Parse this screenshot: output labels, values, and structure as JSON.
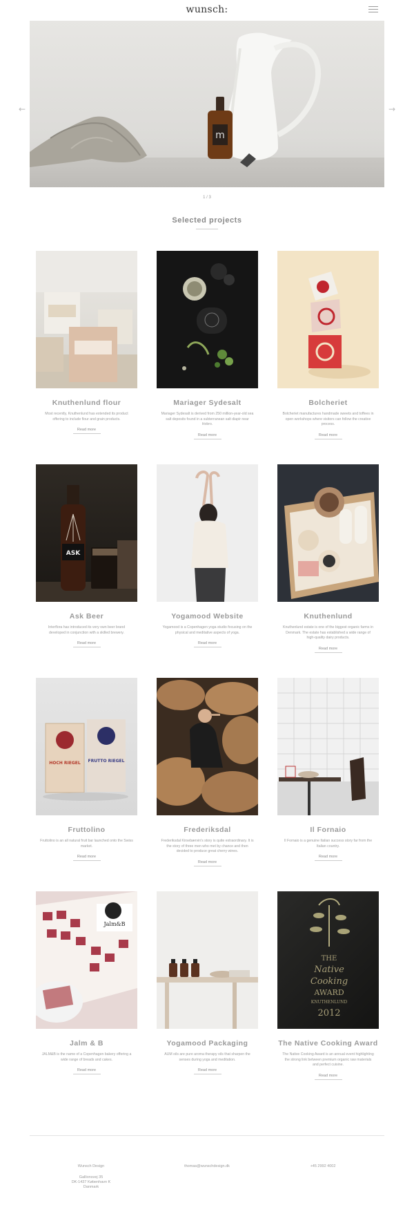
{
  "header": {
    "logo": "wunsch:"
  },
  "hero": {
    "counter": "1 / 3"
  },
  "section_title": "Selected projects",
  "projects": [
    {
      "title": "Knuthenlund flour",
      "desc": "Most recently, Knuthenlund has extended its product offering to include flour and grain products.",
      "more": "Read more"
    },
    {
      "title": "Mariager Sydesalt",
      "desc": "Mariager Sydesalt is derived from 250 million-year-old sea salt deposits found in a subterranean salt diapir near Hobro.",
      "more": "Read more"
    },
    {
      "title": "Bolcheriet",
      "desc": "Bolcheriet manufactures handmade sweets and toffees in open workshops where visitors can follow the creative process.",
      "more": "Read more"
    },
    {
      "title": "Ask Beer",
      "desc": "Interflora has introduced its very own beer brand developed in conjunction with a skilled brewery.",
      "more": "Read more"
    },
    {
      "title": "Yogamood Website",
      "desc": "Yogamood is a Copenhagen yoga studio focusing on the physical and meditative aspects of yoga.",
      "more": "Read more"
    },
    {
      "title": "Knuthenlund",
      "desc": "Knuthenlund estate is one of the biggest organic farms in Denmark. The estate has established a wide range of high-quality dairy products.",
      "more": "Read more"
    },
    {
      "title": "Fruttolino",
      "desc": "Fruttolino is an all natural fruit bar launched onto the Swiss market.",
      "more": "Read more"
    },
    {
      "title": "Frederiksdal",
      "desc": "Frederiksdal Kirsebærvin's story is quite extraordinary. It is the story of three men who met by chance and then decided to produce great cherry wines.",
      "more": "Read more"
    },
    {
      "title": "Il Fornaio",
      "desc": "Il Fornaio is a genuine Italian success story far from the Italian country.",
      "more": "Read more"
    },
    {
      "title": "Jalm & B",
      "desc": "JALM&B is the name of a Copenhagen bakery offering a wide range of breads and cakes.",
      "more": "Read more"
    },
    {
      "title": "Yogamood Packaging",
      "desc": "AUM oils are pure aroma therapy oils that sharpen the senses during yoga and meditation.",
      "more": "Read more"
    },
    {
      "title": "The Native Cooking Award",
      "desc": "The Native Cooking Award is an annual event highlighting the strong link between premium organic raw materials and perfect cuisine.",
      "more": "Read more"
    }
  ],
  "footer": {
    "company": "Wunsch Design",
    "address1": "Gallionsvej 35",
    "address2": "DK-1437 København K",
    "country": "Danmark",
    "email": "thomas@wunschdesign.dk",
    "phone": "+45 2992 4002"
  },
  "image_text": {
    "bottle_label": "m",
    "ask_label": "ASK",
    "fruttolino_a": "HOCH RIEGEL",
    "fruttolino_b": "FRUTTO RIEGEL",
    "jalm_logo": "Jalm&B",
    "award_line1": "THE",
    "award_line2": "Native",
    "award_line3": "Cooking",
    "award_line4": "AWARD",
    "award_line5": "KNUTHENLUND",
    "award_line6": "2012"
  }
}
